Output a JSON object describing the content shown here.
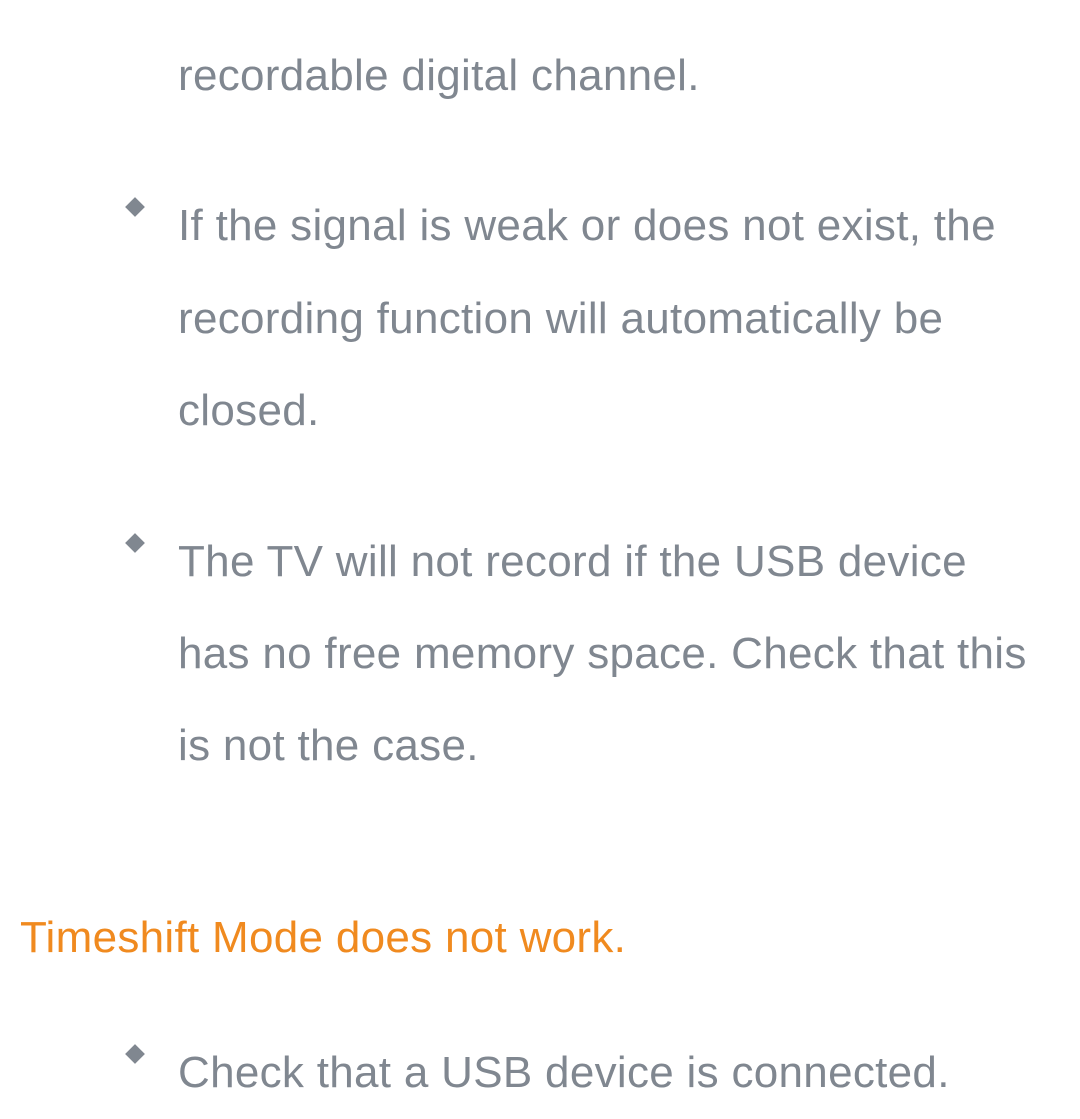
{
  "section1": {
    "fragment": "recordable digital channel.",
    "items": [
      "If the signal is weak or does not exist, the recording function will automatically be closed.",
      "The TV will not record if the USB device has no free memory space. Check that this is not the case."
    ]
  },
  "section2": {
    "heading": "Timeshift Mode does not work.",
    "items": [
      "Check that a USB device is connected."
    ]
  }
}
